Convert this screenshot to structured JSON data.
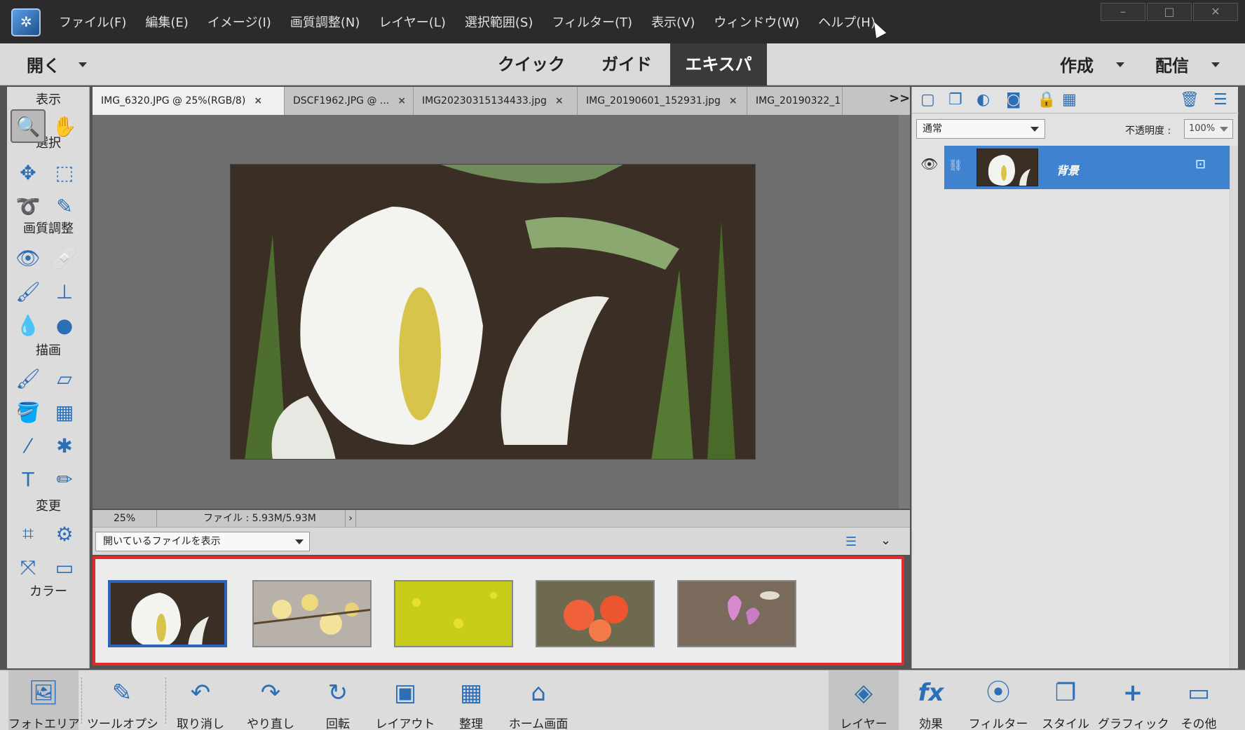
{
  "menu": {
    "items": [
      "ファイル(F)",
      "編集(E)",
      "イメージ(I)",
      "画質調整(N)",
      "レイヤー(L)",
      "選択範囲(S)",
      "フィルター(T)",
      "表示(V)",
      "ウィンドウ(W)",
      "ヘルプ(H)"
    ],
    "window_buttons": [
      "–",
      "□",
      "✕"
    ]
  },
  "modebar": {
    "open_label": "開く",
    "tabs": [
      "クイック",
      "ガイド",
      "エキスパート"
    ],
    "active_tab": "エキスパート",
    "create_label": "作成",
    "share_label": "配信"
  },
  "tools": {
    "headers": [
      "表示",
      "選択",
      "画質調整",
      "描画",
      "変更",
      "カラー"
    ],
    "items": [
      {
        "name": "zoom-tool",
        "glyph": "🔍",
        "active": true
      },
      {
        "name": "hand-tool",
        "glyph": "✋"
      },
      {
        "name": "move-tool",
        "glyph": "✥"
      },
      {
        "name": "marquee-tool",
        "glyph": "⬚"
      },
      {
        "name": "lasso-tool",
        "glyph": "➰"
      },
      {
        "name": "quick-selection-tool",
        "glyph": "✎"
      },
      {
        "name": "red-eye-tool",
        "glyph": "👁"
      },
      {
        "name": "spot-healing-tool",
        "glyph": "🩹"
      },
      {
        "name": "smart-brush-tool",
        "glyph": "🖌"
      },
      {
        "name": "clone-stamp-tool",
        "glyph": "⊥"
      },
      {
        "name": "blur-tool",
        "glyph": "💧"
      },
      {
        "name": "sponge-tool",
        "glyph": "●"
      },
      {
        "name": "brush-tool",
        "glyph": "🖌"
      },
      {
        "name": "eraser-tool",
        "glyph": "▱"
      },
      {
        "name": "paint-bucket-tool",
        "glyph": "🪣"
      },
      {
        "name": "gradient-tool",
        "glyph": "▦"
      },
      {
        "name": "eyedropper-tool",
        "glyph": "⁄"
      },
      {
        "name": "custom-shape-tool",
        "glyph": "✱"
      },
      {
        "name": "type-tool",
        "glyph": "T"
      },
      {
        "name": "pencil-tool",
        "glyph": "✏"
      },
      {
        "name": "crop-tool",
        "glyph": "⌗"
      },
      {
        "name": "recompose-tool",
        "glyph": "⚙"
      },
      {
        "name": "content-aware-move-tool",
        "glyph": "⤧"
      },
      {
        "name": "straighten-tool",
        "glyph": "▭"
      }
    ]
  },
  "doc_tabs": [
    {
      "label": "IMG_6320.JPG @ 25%(RGB/8)",
      "active": true
    },
    {
      "label": "DSCF1962.JPG @ ..."
    },
    {
      "label": "IMG20230315134433.jpg"
    },
    {
      "label": "IMG_20190601_152931.jpg"
    },
    {
      "label": "IMG_20190322_1"
    }
  ],
  "tabs_more": ">>",
  "status": {
    "zoom": "25%",
    "file_info": "ファイル : 5.93M/5.93M"
  },
  "bin": {
    "select_value": "開いているファイルを表示",
    "thumbs": [
      "skunk-cabbage",
      "yellow-blossoms",
      "rapeseed-field",
      "red-azaleas",
      "pink-dogtooth-violet"
    ]
  },
  "layers": {
    "blend_mode": "通常",
    "opacity_label": "不透明度 :",
    "opacity_value": "100%",
    "layer_name": "背景"
  },
  "taskbar": {
    "left": [
      {
        "name": "photo-bin-button",
        "icon": "🖼",
        "label": "フォトエリア",
        "active": true
      },
      {
        "name": "tool-options-button",
        "icon": "✎",
        "label": "ツールオプシ..."
      },
      {
        "name": "undo-button",
        "icon": "↶",
        "label": "取り消し"
      },
      {
        "name": "redo-button",
        "icon": "↷",
        "label": "やり直し"
      },
      {
        "name": "rotate-button",
        "icon": "↻",
        "label": "回転"
      },
      {
        "name": "layout-button",
        "icon": "▣",
        "label": "レイアウト"
      },
      {
        "name": "organizer-button",
        "icon": "▦",
        "label": "整理"
      },
      {
        "name": "home-screen-button",
        "icon": "⌂",
        "label": "ホーム画面"
      }
    ],
    "right": [
      {
        "name": "layers-button",
        "icon": "◈",
        "label": "レイヤー",
        "active": true
      },
      {
        "name": "effects-button",
        "icon": "fx",
        "label": "効果"
      },
      {
        "name": "filters-button",
        "icon": "⦿",
        "label": "フィルター"
      },
      {
        "name": "styles-button",
        "icon": "❐",
        "label": "スタイル"
      },
      {
        "name": "graphics-button",
        "icon": "+",
        "label": "グラフィック"
      },
      {
        "name": "more-button",
        "icon": "▭",
        "label": "その他"
      }
    ]
  }
}
